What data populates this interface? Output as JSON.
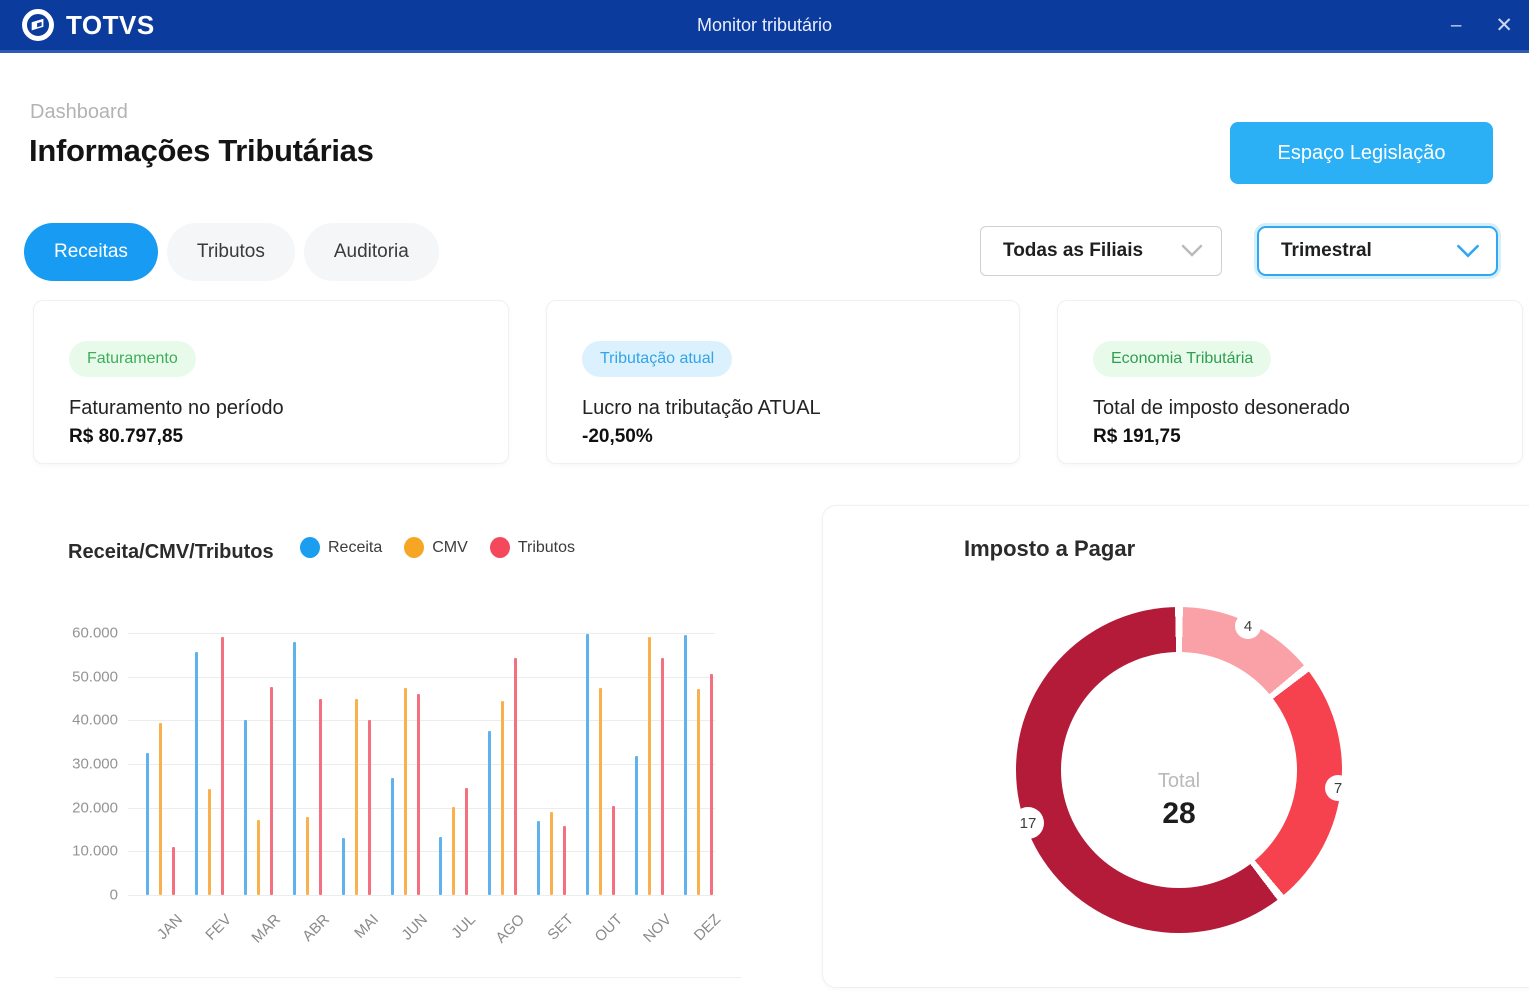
{
  "colors": {
    "header_blue": "#0c3b9e",
    "accent": "#189bf2",
    "accent_light": "#2bb0f5",
    "accent_focus": "#2fa8f1"
  },
  "window": {
    "brand": "TOTVS",
    "title": "Monitor tributário",
    "minimize_icon": "–",
    "close_icon": "✕"
  },
  "page": {
    "breadcrumb": "Dashboard",
    "title": "Informações Tributárias",
    "action_button": "Espaço Legislação"
  },
  "tabs": [
    {
      "label": "Receitas",
      "active": true
    },
    {
      "label": "Tributos",
      "active": false
    },
    {
      "label": "Auditoria",
      "active": false
    }
  ],
  "filters": {
    "branch_value": "Todas as Filiais",
    "period_value": "Trimestral"
  },
  "cards": [
    {
      "badge": "Faturamento",
      "badge_bg": "#e8fbea",
      "badge_color": "#3fae5a",
      "label": "Faturamento no período",
      "value": "R$ 80.797,85"
    },
    {
      "badge": "Tributação atual",
      "badge_bg": "#dbf2fe",
      "badge_color": "#35a3e8",
      "label": "Lucro na tributação ATUAL",
      "value": "-20,50%"
    },
    {
      "badge": "Economia Tributária",
      "badge_bg": "#e8fbea",
      "badge_color": "#2f9e4f",
      "label": "Total de imposto desonerado",
      "value": "R$ 191,75"
    }
  ],
  "chart_data": [
    {
      "type": "bar",
      "title": "Receita/CMV/Tributos",
      "categories": [
        "JAN",
        "FEV",
        "MAR",
        "ABR",
        "MAI",
        "JUN",
        "JUL",
        "AGO",
        "SET",
        "OUT",
        "NOV",
        "DEZ"
      ],
      "series": [
        {
          "name": "Receita",
          "color": "#5fb2ec",
          "legend_color": "#1b9df0",
          "values": [
            32500,
            55700,
            40000,
            58000,
            13000,
            26800,
            13300,
            37500,
            17000,
            59800,
            31800,
            59600
          ]
        },
        {
          "name": "CMV",
          "color": "#f9b14e",
          "legend_color": "#f6a623",
          "values": [
            39500,
            24200,
            17200,
            17800,
            44900,
            47400,
            20200,
            44500,
            19000,
            47400,
            59000,
            47200
          ]
        },
        {
          "name": "Tributos",
          "color": "#f5707f",
          "legend_color": "#f4495c",
          "values": [
            11000,
            59000,
            47700,
            44800,
            40000,
            46000,
            24500,
            54300,
            15800,
            20300,
            54200,
            50700
          ]
        }
      ],
      "ylim": [
        0,
        60000
      ],
      "yticks": [
        "60.000",
        "50.000",
        "40.000",
        "30.000",
        "20.000",
        "10.000",
        "0"
      ],
      "grid": true,
      "legend_position": "top"
    },
    {
      "type": "pie",
      "subtype": "donut",
      "title": "Imposto a Pagar",
      "center_label": "Total",
      "center_value": "28",
      "slices": [
        {
          "label": "4",
          "value": 4,
          "color": "#f9a1a7"
        },
        {
          "label": "7",
          "value": 7,
          "color": "#f5424e"
        },
        {
          "label": "17",
          "value": 17,
          "color": "#b31b38"
        }
      ],
      "start_angle_deg": 0,
      "direction": "clockwise"
    }
  ]
}
